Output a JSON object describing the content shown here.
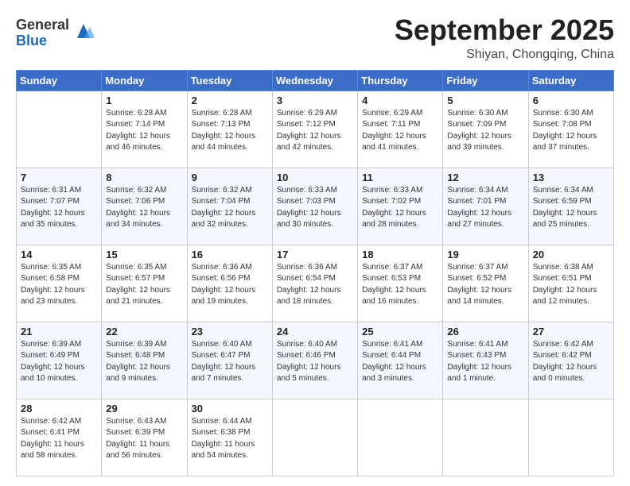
{
  "header": {
    "logo_general": "General",
    "logo_blue": "Blue",
    "month_title": "September 2025",
    "subtitle": "Shiyan, Chongqing, China"
  },
  "weekdays": [
    "Sunday",
    "Monday",
    "Tuesday",
    "Wednesday",
    "Thursday",
    "Friday",
    "Saturday"
  ],
  "weeks": [
    [
      {
        "day": "",
        "info": ""
      },
      {
        "day": "1",
        "info": "Sunrise: 6:28 AM\nSunset: 7:14 PM\nDaylight: 12 hours\nand 46 minutes."
      },
      {
        "day": "2",
        "info": "Sunrise: 6:28 AM\nSunset: 7:13 PM\nDaylight: 12 hours\nand 44 minutes."
      },
      {
        "day": "3",
        "info": "Sunrise: 6:29 AM\nSunset: 7:12 PM\nDaylight: 12 hours\nand 42 minutes."
      },
      {
        "day": "4",
        "info": "Sunrise: 6:29 AM\nSunset: 7:11 PM\nDaylight: 12 hours\nand 41 minutes."
      },
      {
        "day": "5",
        "info": "Sunrise: 6:30 AM\nSunset: 7:09 PM\nDaylight: 12 hours\nand 39 minutes."
      },
      {
        "day": "6",
        "info": "Sunrise: 6:30 AM\nSunset: 7:08 PM\nDaylight: 12 hours\nand 37 minutes."
      }
    ],
    [
      {
        "day": "7",
        "info": "Sunrise: 6:31 AM\nSunset: 7:07 PM\nDaylight: 12 hours\nand 35 minutes."
      },
      {
        "day": "8",
        "info": "Sunrise: 6:32 AM\nSunset: 7:06 PM\nDaylight: 12 hours\nand 34 minutes."
      },
      {
        "day": "9",
        "info": "Sunrise: 6:32 AM\nSunset: 7:04 PM\nDaylight: 12 hours\nand 32 minutes."
      },
      {
        "day": "10",
        "info": "Sunrise: 6:33 AM\nSunset: 7:03 PM\nDaylight: 12 hours\nand 30 minutes."
      },
      {
        "day": "11",
        "info": "Sunrise: 6:33 AM\nSunset: 7:02 PM\nDaylight: 12 hours\nand 28 minutes."
      },
      {
        "day": "12",
        "info": "Sunrise: 6:34 AM\nSunset: 7:01 PM\nDaylight: 12 hours\nand 27 minutes."
      },
      {
        "day": "13",
        "info": "Sunrise: 6:34 AM\nSunset: 6:59 PM\nDaylight: 12 hours\nand 25 minutes."
      }
    ],
    [
      {
        "day": "14",
        "info": "Sunrise: 6:35 AM\nSunset: 6:58 PM\nDaylight: 12 hours\nand 23 minutes."
      },
      {
        "day": "15",
        "info": "Sunrise: 6:35 AM\nSunset: 6:57 PM\nDaylight: 12 hours\nand 21 minutes."
      },
      {
        "day": "16",
        "info": "Sunrise: 6:36 AM\nSunset: 6:56 PM\nDaylight: 12 hours\nand 19 minutes."
      },
      {
        "day": "17",
        "info": "Sunrise: 6:36 AM\nSunset: 6:54 PM\nDaylight: 12 hours\nand 18 minutes."
      },
      {
        "day": "18",
        "info": "Sunrise: 6:37 AM\nSunset: 6:53 PM\nDaylight: 12 hours\nand 16 minutes."
      },
      {
        "day": "19",
        "info": "Sunrise: 6:37 AM\nSunset: 6:52 PM\nDaylight: 12 hours\nand 14 minutes."
      },
      {
        "day": "20",
        "info": "Sunrise: 6:38 AM\nSunset: 6:51 PM\nDaylight: 12 hours\nand 12 minutes."
      }
    ],
    [
      {
        "day": "21",
        "info": "Sunrise: 6:39 AM\nSunset: 6:49 PM\nDaylight: 12 hours\nand 10 minutes."
      },
      {
        "day": "22",
        "info": "Sunrise: 6:39 AM\nSunset: 6:48 PM\nDaylight: 12 hours\nand 9 minutes."
      },
      {
        "day": "23",
        "info": "Sunrise: 6:40 AM\nSunset: 6:47 PM\nDaylight: 12 hours\nand 7 minutes."
      },
      {
        "day": "24",
        "info": "Sunrise: 6:40 AM\nSunset: 6:46 PM\nDaylight: 12 hours\nand 5 minutes."
      },
      {
        "day": "25",
        "info": "Sunrise: 6:41 AM\nSunset: 6:44 PM\nDaylight: 12 hours\nand 3 minutes."
      },
      {
        "day": "26",
        "info": "Sunrise: 6:41 AM\nSunset: 6:43 PM\nDaylight: 12 hours\nand 1 minute."
      },
      {
        "day": "27",
        "info": "Sunrise: 6:42 AM\nSunset: 6:42 PM\nDaylight: 12 hours\nand 0 minutes."
      }
    ],
    [
      {
        "day": "28",
        "info": "Sunrise: 6:42 AM\nSunset: 6:41 PM\nDaylight: 11 hours\nand 58 minutes."
      },
      {
        "day": "29",
        "info": "Sunrise: 6:43 AM\nSunset: 6:39 PM\nDaylight: 11 hours\nand 56 minutes."
      },
      {
        "day": "30",
        "info": "Sunrise: 6:44 AM\nSunset: 6:38 PM\nDaylight: 11 hours\nand 54 minutes."
      },
      {
        "day": "",
        "info": ""
      },
      {
        "day": "",
        "info": ""
      },
      {
        "day": "",
        "info": ""
      },
      {
        "day": "",
        "info": ""
      }
    ]
  ]
}
